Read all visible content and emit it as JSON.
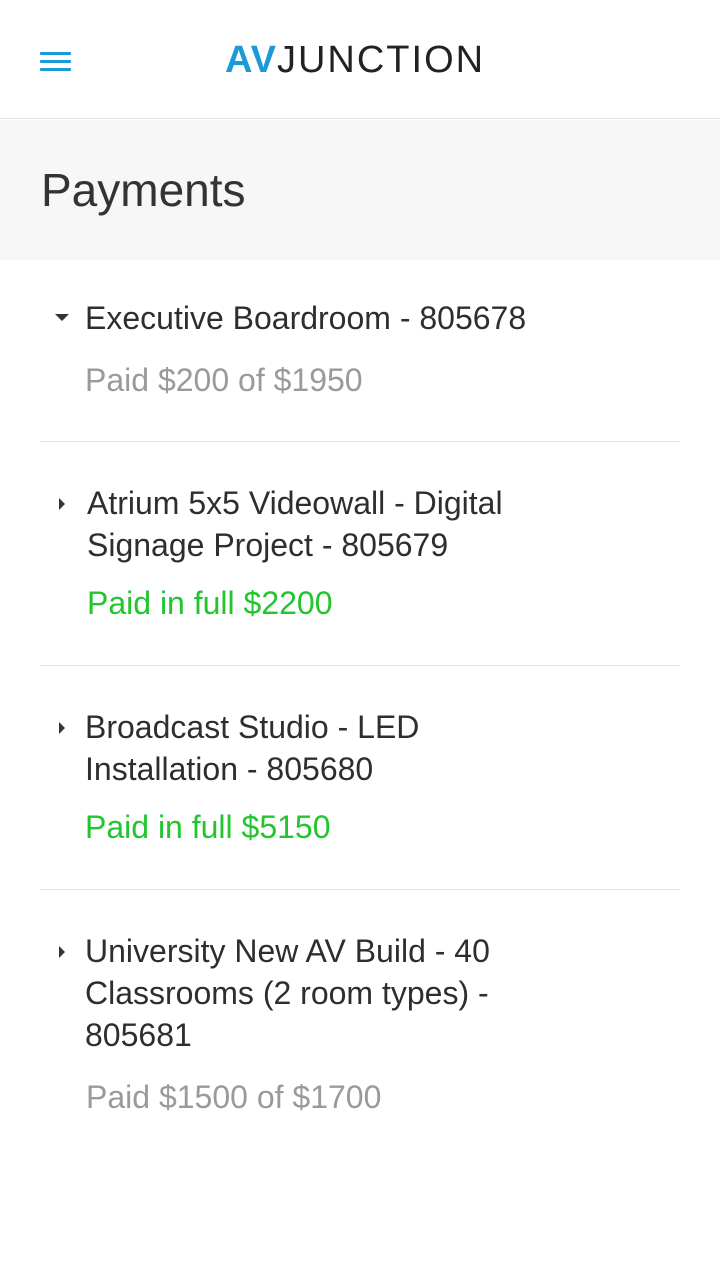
{
  "brand": {
    "av": "AV",
    "junction": "JUNCTION"
  },
  "page": {
    "title": "Payments"
  },
  "icons": {
    "menu": "hamburger-menu-icon",
    "expanded": "caret-down-icon",
    "collapsed": "caret-right-icon"
  },
  "colors": {
    "brand_blue": "#1a9bd7",
    "paid_full": "#22c52e",
    "paid_partial": "#9a9a9a"
  },
  "payments": [
    {
      "title": "Executive Boardroom - 805678",
      "status": "Paid $200 of $1950",
      "state": "partial",
      "expanded": true
    },
    {
      "title": "Atrium 5x5 Videowall - Digital Signage Project - 805679",
      "status": "Paid in full $2200",
      "state": "full",
      "expanded": false
    },
    {
      "title": "Broadcast Studio - LED Installation - 805680",
      "status": "Paid in full $5150",
      "state": "full",
      "expanded": false
    },
    {
      "title": "University New AV Build - 40 Classrooms (2 room types) - 805681",
      "status": "Paid $1500 of $1700",
      "state": "partial",
      "expanded": false
    }
  ]
}
